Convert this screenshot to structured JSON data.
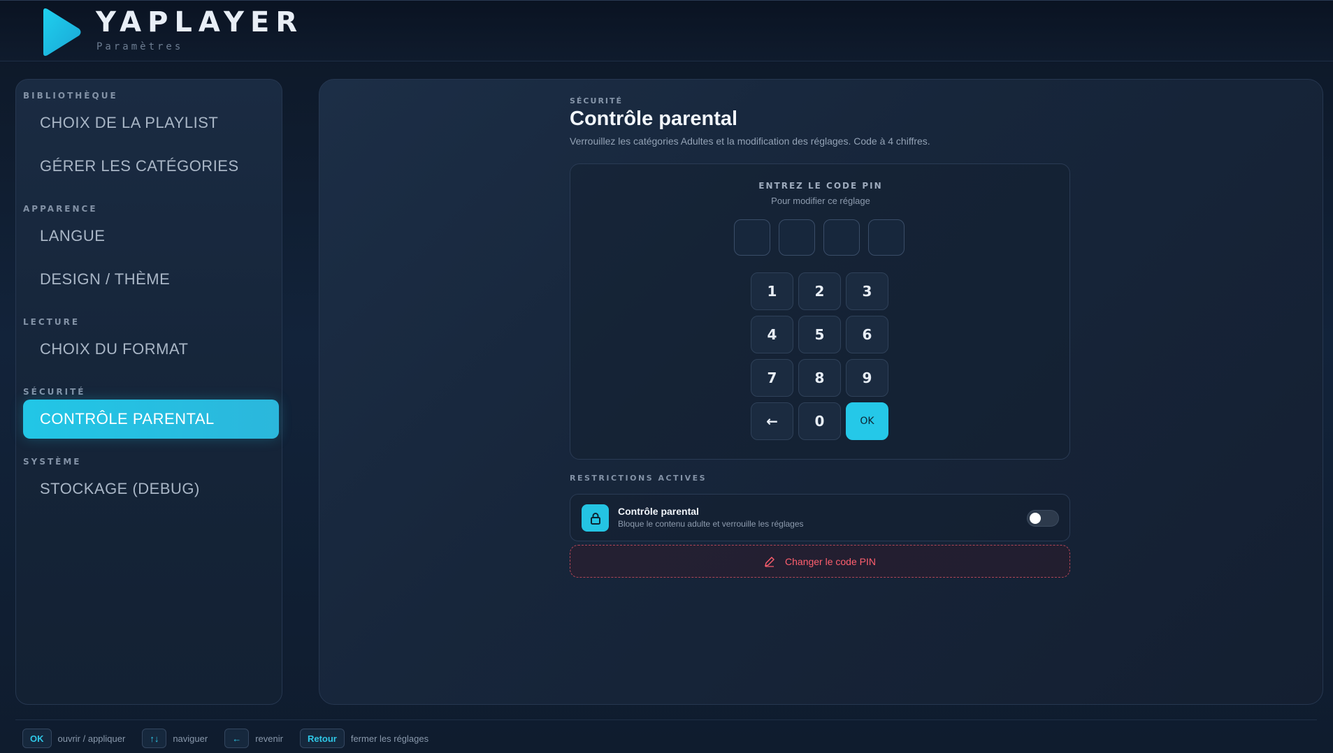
{
  "header": {
    "brand": "YAPLAYER",
    "subtitle": "Paramètres",
    "logo_icon": "play-triangle-icon",
    "accent": "#22c6e6"
  },
  "sidebar": {
    "sections": [
      {
        "label": "BIBLIOTHÈQUE",
        "items": [
          {
            "label": "CHOIX DE LA PLAYLIST"
          },
          {
            "label": "GÉRER LES CATÉGORIES"
          }
        ]
      },
      {
        "label": "APPARENCE",
        "items": [
          {
            "label": "LANGUE"
          },
          {
            "label": "DESIGN / THÈME"
          }
        ]
      },
      {
        "label": "LECTURE",
        "items": [
          {
            "label": "CHOIX DU FORMAT"
          }
        ]
      },
      {
        "label": "SÉCURITÉ",
        "items": [
          {
            "label": "CONTRÔLE PARENTAL",
            "active": true
          }
        ]
      },
      {
        "label": "SYSTÈME",
        "items": [
          {
            "label": "STOCKAGE (DEBUG)"
          }
        ]
      }
    ]
  },
  "main": {
    "eyebrow": "SÉCURITÉ",
    "title": "Contrôle parental",
    "description": "Verrouillez les catégories Adultes et la modification des réglages. Code à 4 chiffres.",
    "pin": {
      "label": "ENTREZ LE CODE PIN",
      "sublabel": "Pour modifier ce réglage",
      "slots": [
        "",
        "",
        "",
        ""
      ],
      "keys": [
        "1",
        "2",
        "3",
        "4",
        "5",
        "6",
        "7",
        "8",
        "9",
        "←",
        "0",
        "OK"
      ]
    },
    "restrictions": {
      "label": "RESTRICTIONS ACTIVES",
      "items": [
        {
          "icon": "lock-icon",
          "title": "Contrôle parental",
          "description": "Bloque le contenu adulte et verrouille les réglages",
          "enabled": false
        }
      ]
    },
    "change_pin": {
      "icon": "pencil-icon",
      "label": "Changer le code PIN",
      "color": "#ff5f6e"
    }
  },
  "footer": {
    "hints": [
      {
        "key": "OK",
        "text": "ouvrir / appliquer"
      },
      {
        "key": "↑↓",
        "text": "naviguer"
      },
      {
        "key": "←",
        "text": "revenir"
      },
      {
        "key": "Retour",
        "text": "fermer les réglages"
      }
    ]
  }
}
